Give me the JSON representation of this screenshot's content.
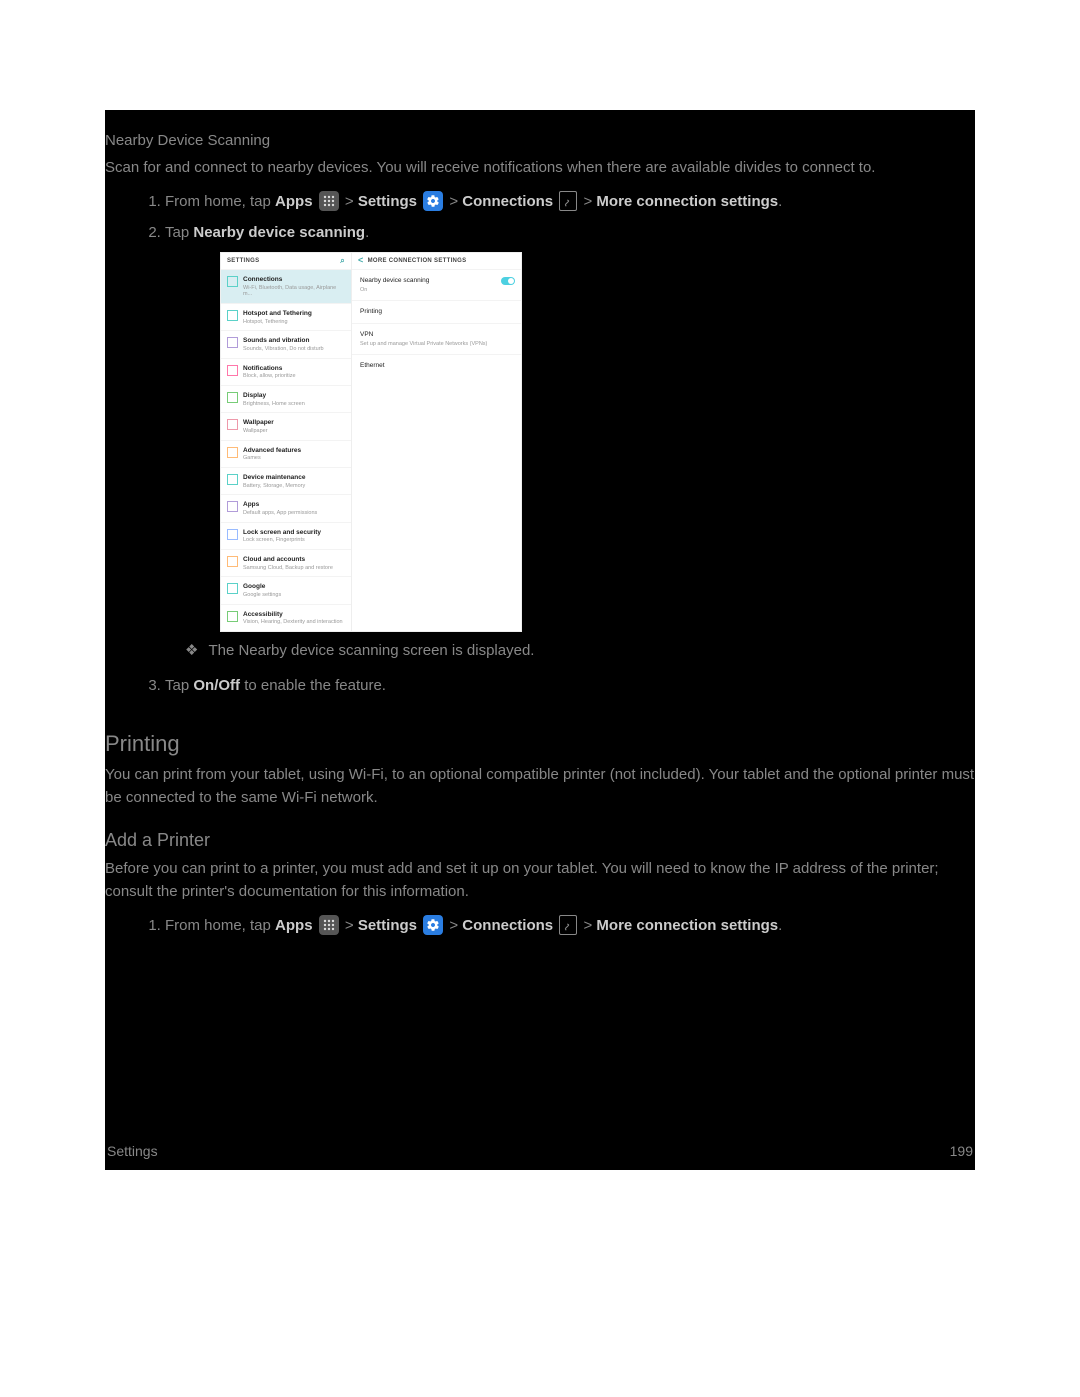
{
  "nearby": {
    "title": "Nearby Device Scanning",
    "intro": "Scan for and connect to nearby devices. You will receive notifications when there are available divides to connect to.",
    "steps": {
      "1_prefix": "From home, tap ",
      "apps": "Apps",
      "settings": "Settings",
      "connections": "Connections",
      "more": "More connection settings",
      "2_prefix": "Tap ",
      "2_bold": "Nearby device scanning",
      "note": "The Nearby device scanning screen is displayed.",
      "3_prefix": "Tap ",
      "3_bold": "On/Off",
      "3_suffix": " to enable the feature."
    }
  },
  "screenshot": {
    "left_header": "SETTINGS",
    "right_header": "MORE CONNECTION SETTINGS",
    "items": [
      {
        "title": "Connections",
        "sub": "Wi-Fi, Bluetooth, Data usage, Airplane m...",
        "active": true,
        "color": "#5bd1c8"
      },
      {
        "title": "Hotspot and Tethering",
        "sub": "Hotspot, Tethering",
        "color": "#5bd1c8"
      },
      {
        "title": "Sounds and vibration",
        "sub": "Sounds, Vibration, Do not disturb",
        "color": "#b19cd9"
      },
      {
        "title": "Notifications",
        "sub": "Block, allow, prioritize",
        "color": "#f7a"
      },
      {
        "title": "Display",
        "sub": "Brightness, Home screen",
        "color": "#7c7"
      },
      {
        "title": "Wallpaper",
        "sub": "Wallpaper",
        "color": "#e9a"
      },
      {
        "title": "Advanced features",
        "sub": "Games",
        "color": "#fb7"
      },
      {
        "title": "Device maintenance",
        "sub": "Battery, Storage, Memory",
        "color": "#5bd1c8"
      },
      {
        "title": "Apps",
        "sub": "Default apps, App permissions",
        "color": "#b19cd9"
      },
      {
        "title": "Lock screen and security",
        "sub": "Lock screen, Fingerprints",
        "color": "#9bf"
      },
      {
        "title": "Cloud and accounts",
        "sub": "Samsung Cloud, Backup and restore",
        "color": "#fb7"
      },
      {
        "title": "Google",
        "sub": "Google settings",
        "color": "#5bd1c8"
      },
      {
        "title": "Accessibility",
        "sub": "Vision, Hearing, Dexterity and interaction",
        "color": "#7c7"
      }
    ],
    "right_items": [
      {
        "title": "Nearby device scanning",
        "sub": "On",
        "toggle": true
      },
      {
        "title": "Printing",
        "sub": ""
      },
      {
        "title": "VPN",
        "sub": "Set up and manage Virtual Private Networks (VPNs)"
      },
      {
        "title": "Ethernet",
        "sub": ""
      }
    ]
  },
  "printing": {
    "title": "Printing",
    "intro": "You can print from your tablet, using Wi-Fi, to an optional compatible printer (not included). Your tablet and the optional printer must be connected to the same Wi-Fi network.",
    "add_title": "Add a Printer",
    "add_intro": "Before you can print to a printer, you must add and set it up on your tablet. You will need to know the IP address of the printer; consult the printer's documentation for this information."
  },
  "footer": {
    "left": "Settings",
    "right": "199"
  }
}
